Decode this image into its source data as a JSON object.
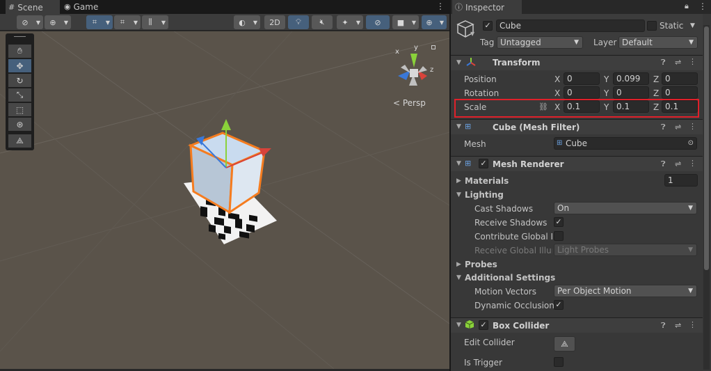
{
  "scene_tabs": [
    {
      "label": "Scene",
      "icon": "grid-icon"
    },
    {
      "label": "Game",
      "icon": "gamepad-icon"
    }
  ],
  "toolbar": {
    "mode_2d_label": "2D"
  },
  "gizmo": {
    "projection_label": "< Persp",
    "axis_x": "x",
    "axis_y": "y",
    "axis_z": "z"
  },
  "inspector": {
    "tab_label": "Inspector",
    "object": {
      "name": "Cube",
      "active": true,
      "static_label": "Static",
      "tag_label": "Tag",
      "tag_value": "Untagged",
      "layer_label": "Layer",
      "layer_value": "Default"
    },
    "transform": {
      "title": "Transform",
      "position_label": "Position",
      "rotation_label": "Rotation",
      "scale_label": "Scale",
      "position": {
        "x": "0",
        "y": "0.099",
        "z": "0"
      },
      "rotation": {
        "x": "0",
        "y": "0",
        "z": "0"
      },
      "scale": {
        "x": "0.1",
        "y": "0.1",
        "z": "0.1"
      },
      "axes": {
        "x": "X",
        "y": "Y",
        "z": "Z"
      },
      "highlight_color": "#e0202a"
    },
    "mesh_filter": {
      "title": "Cube (Mesh Filter)",
      "mesh_label": "Mesh",
      "mesh_value": "Cube"
    },
    "mesh_renderer": {
      "title": "Mesh Renderer",
      "enabled": true,
      "materials_label": "Materials",
      "materials_count": "1",
      "lighting_label": "Lighting",
      "cast_shadows_label": "Cast Shadows",
      "cast_shadows_value": "On",
      "receive_shadows_label": "Receive Shadows",
      "receive_shadows": true,
      "contribute_gi_label": "Contribute Global Illu",
      "contribute_gi": false,
      "receive_gi_label": "Receive Global Illum",
      "receive_gi_value": "Light Probes",
      "probes_label": "Probes",
      "additional_label": "Additional Settings",
      "motion_vectors_label": "Motion Vectors",
      "motion_vectors_value": "Per Object Motion",
      "dynamic_occlusion_label": "Dynamic Occlusion",
      "dynamic_occlusion": true
    },
    "box_collider": {
      "title": "Box Collider",
      "enabled": true,
      "edit_collider_label": "Edit Collider",
      "is_trigger_label": "Is Trigger",
      "is_trigger": false
    }
  },
  "colors": {
    "accent_blue": "#46607c",
    "selection_orange": "#f57c1f",
    "gizmo_red": "#d8433a",
    "gizmo_green": "#8ad23a",
    "gizmo_blue": "#3a78d8"
  }
}
